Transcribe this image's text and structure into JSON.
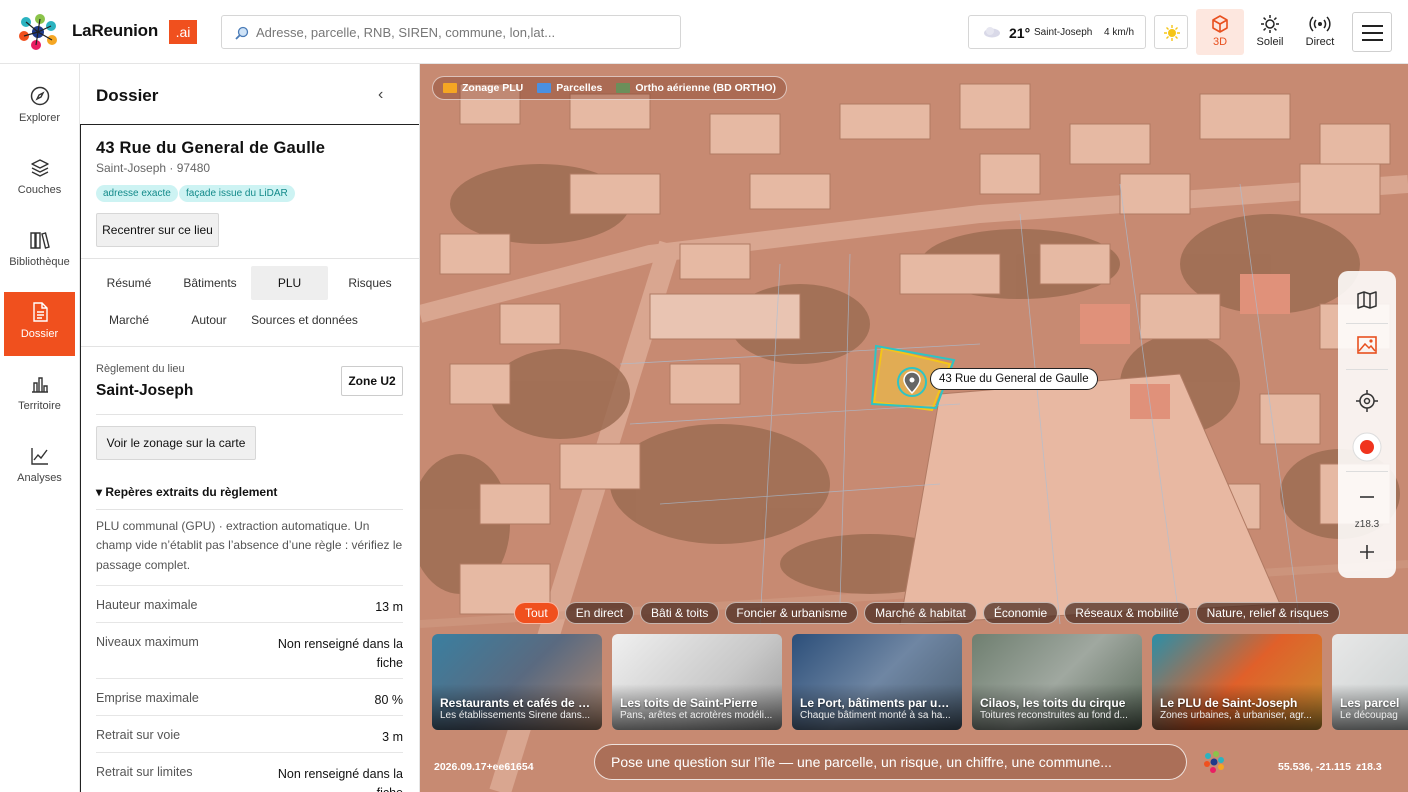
{
  "app": {
    "brand": "LaReunion",
    "brand_suffix": ".ai"
  },
  "search": {
    "placeholder": "Adresse, parcelle, RNB, SIREN, commune, lon,lat..."
  },
  "weather": {
    "temp": "21°",
    "city": "Saint-Joseph",
    "wind": "4 km/h"
  },
  "toolbar": {
    "mode_3d": "3D",
    "sun": "Soleil",
    "live": "Direct"
  },
  "nav": [
    {
      "label": "Explorer",
      "icon": "compass-icon"
    },
    {
      "label": "Couches",
      "icon": "layers-icon"
    },
    {
      "label": "Bibliothèque",
      "icon": "books-icon"
    },
    {
      "label": "Dossier",
      "icon": "document-icon",
      "active": true
    },
    {
      "label": "Territoire",
      "icon": "bar-chart-icon"
    },
    {
      "label": "Analyses",
      "icon": "line-chart-icon"
    }
  ],
  "panel": {
    "title": "Dossier",
    "collapse": "‹",
    "address": "43 Rue du General de Gaulle",
    "locality": "Saint-Joseph · 97480",
    "chips": [
      "adresse exacte",
      "façade issue du LiDAR"
    ],
    "recenter": "Recentrer sur ce lieu",
    "tabs": [
      "Résumé",
      "Bâtiments",
      "PLU",
      "Risques",
      "Marché",
      "Autour",
      "Sources et données"
    ],
    "active_tab": "PLU",
    "reglement_label": "Règlement du lieu",
    "commune": "Saint-Joseph",
    "zone": "Zone U2",
    "zoning_button": "Voir le zonage sur la carte",
    "reperes_title": "▾ Repères extraits du règlement",
    "note": "PLU communal (GPU) · extraction automatique. Un champ vide n’établit pas l’absence d’une règle : vérifiez le passage complet.",
    "rows": [
      {
        "label": "Hauteur maximale",
        "value": "13 m"
      },
      {
        "label": "Niveaux maximum",
        "value": "Non renseigné dans la fiche"
      },
      {
        "label": "Emprise maximale",
        "value": "80 %"
      },
      {
        "label": "Retrait sur voie",
        "value": "3 m"
      },
      {
        "label": "Retrait sur limites",
        "value": "Non renseigné dans la fiche"
      }
    ]
  },
  "map": {
    "legend": [
      {
        "label": "Zonage PLU",
        "color": "#f5a623"
      },
      {
        "label": "Parcelles",
        "color": "#4a90e2"
      },
      {
        "label": "Ortho aérienne (BD ORTHO)",
        "color": "#6b8f5a"
      }
    ],
    "pin_label": "43 Rue du General de Gaulle",
    "zoom": "z18.3",
    "filters": [
      "Tout",
      "En direct",
      "Bâti & toits",
      "Foncier & urbanisme",
      "Marché & habitat",
      "Économie",
      "Réseaux & mobilité",
      "Nature, relief & risques"
    ],
    "active_filter": "Tout",
    "cards": [
      {
        "title": "Restaurants et cafés de Sa...",
        "desc": "Les établissements Sirene dans..."
      },
      {
        "title": "Les toits de Saint-Pierre",
        "desc": "Pans, arêtes et acrotères modéli..."
      },
      {
        "title": "Le Port, bâtiments par usa...",
        "desc": "Chaque bâtiment monté à sa ha..."
      },
      {
        "title": "Cilaos, les toits du cirque",
        "desc": "Toitures reconstruites au fond d..."
      },
      {
        "title": "Le PLU de Saint-Joseph",
        "desc": "Zones urbaines, à urbaniser, agr..."
      },
      {
        "title": "Les parcel",
        "desc": "Le découpag"
      }
    ],
    "ask_placeholder": "Pose une question sur l’île — une parcelle, un risque, un chiffre, une commune...",
    "build": "2026.09.17+ee61654",
    "coords": "55.536, -21.115",
    "zoom_bottom": "z18.3"
  }
}
